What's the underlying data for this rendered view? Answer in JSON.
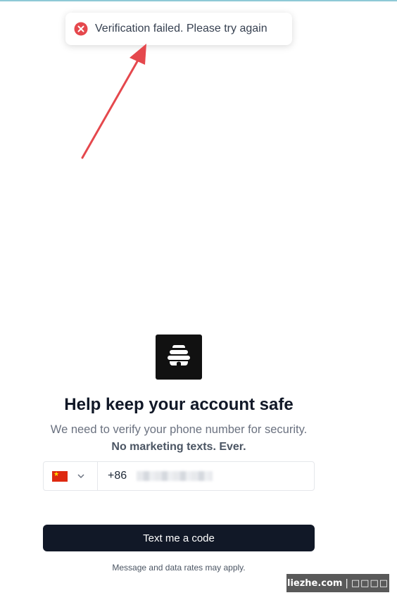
{
  "toast": {
    "message": "Verification failed. Please try again",
    "icon": "error-x-circle-icon",
    "icon_color": "#e5484d"
  },
  "annotation": {
    "arrow_color": "#e5484d"
  },
  "logo": {
    "icon": "beehive-icon",
    "background": "#111111"
  },
  "heading": {
    "title": "Help keep your account safe",
    "subtitle": "We need to verify your phone number for security.",
    "subtitle_strong": "No marketing texts. Ever."
  },
  "phone_input": {
    "country_flag": "china-flag-icon",
    "country_dial_code": "+86",
    "value_masked": true
  },
  "cta": {
    "label": "Text me a code",
    "background": "#111827"
  },
  "disclaimer": "Message and data rates may apply.",
  "watermark": {
    "site": "liezhe.com",
    "separator": "|",
    "suffix": "□□□□"
  }
}
